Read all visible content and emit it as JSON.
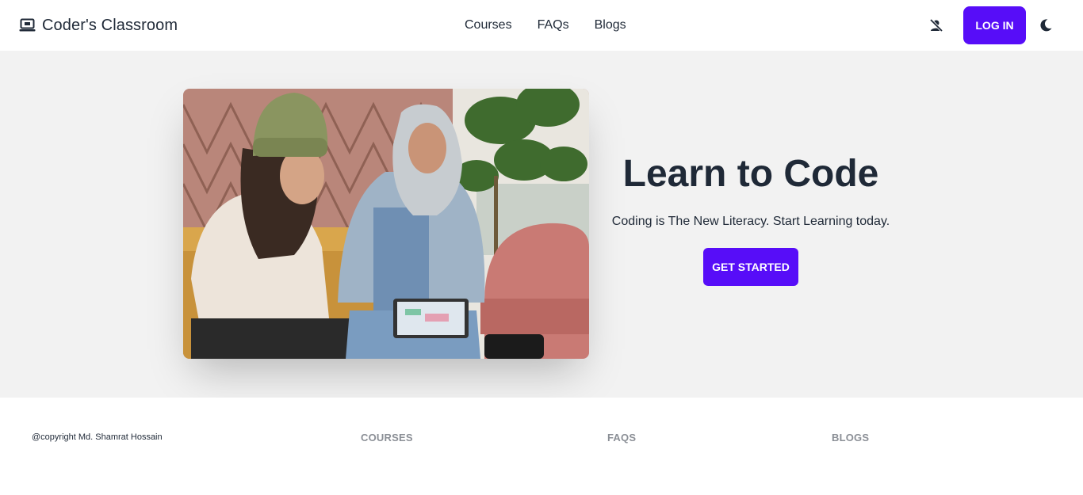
{
  "nav": {
    "brand_icon": "laptop-icon",
    "brand_title": "Coder's Classroom",
    "links": [
      "Courses",
      "FAQs",
      "Blogs"
    ],
    "user_icon": "user-off-icon",
    "login_label": "LOG IN",
    "theme_icon": "moon-icon"
  },
  "hero": {
    "image_alt": "two-women-talking-with-tablet-photo",
    "title": "Learn to Code",
    "subtitle": "Coding is The New Literacy. Start Learning today.",
    "cta_label": "GET STARTED"
  },
  "footer": {
    "copyright": "@copyright Md. Shamrat Hossain",
    "links": [
      "COURSES",
      "FAQS",
      "BLOGS"
    ]
  },
  "colors": {
    "primary": "#570df8",
    "hero_bg": "#f2f2f2",
    "text": "#1f2937",
    "footer_link": "#8b8f96"
  }
}
